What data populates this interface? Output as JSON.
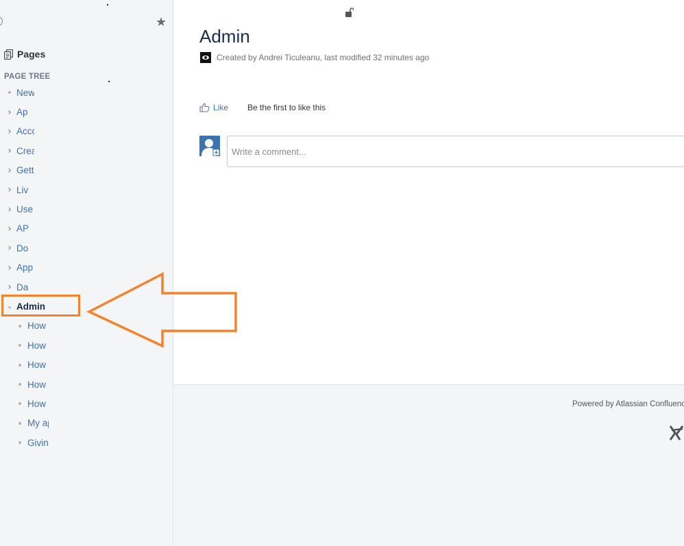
{
  "sidebar": {
    "pages_label": "Pages",
    "tree_heading": "PAGE TREE",
    "items": [
      {
        "label": "New",
        "marker": "bullet",
        "level": 0
      },
      {
        "label": "Ap",
        "marker": "chevron-right",
        "level": 0
      },
      {
        "label": "Acco",
        "marker": "chevron-right",
        "level": 0
      },
      {
        "label": "Crea",
        "marker": "chevron-right",
        "level": 0
      },
      {
        "label": "Getti",
        "marker": "chevron-right",
        "level": 0
      },
      {
        "label": "Liv",
        "marker": "chevron-right",
        "level": 0
      },
      {
        "label": "Use",
        "marker": "chevron-right",
        "level": 0
      },
      {
        "label": "AP",
        "marker": "chevron-right",
        "level": 0
      },
      {
        "label": "Do",
        "marker": "chevron-right",
        "level": 0
      },
      {
        "label": "App",
        "marker": "chevron-right",
        "level": 0
      },
      {
        "label": "Da",
        "marker": "chevron-right",
        "level": 0
      },
      {
        "label": "Admin",
        "marker": "chevron-down",
        "level": 0,
        "current": true
      },
      {
        "label": "How",
        "marker": "bullet",
        "level": 1
      },
      {
        "label": "How",
        "marker": "bullet",
        "level": 1
      },
      {
        "label": "How",
        "marker": "bullet",
        "level": 1
      },
      {
        "label": "How",
        "marker": "bullet",
        "level": 1
      },
      {
        "label": "How",
        "marker": "bullet",
        "level": 1
      },
      {
        "label": "My ap",
        "marker": "bullet",
        "level": 1
      },
      {
        "label": "Givin",
        "marker": "bullet",
        "level": 1
      }
    ]
  },
  "page": {
    "title": "Admin",
    "byline": "Created by Andrei Ticuleanu, last modified 32 minutes ago",
    "like_label": "Like",
    "like_prompt": "Be the first to like this",
    "comment_placeholder": "Write a comment..."
  },
  "footer": {
    "powered_by": "Powered by Atlassian Confluence"
  },
  "icons": {
    "star": "star-icon",
    "lock": "unlocked-icon",
    "pages": "pages-icon",
    "like": "thumbs-up-icon",
    "avatar": "user-avatar-icon",
    "logo": "atlassian-logo-icon"
  },
  "colors": {
    "link": "#3b73af",
    "highlight": "#f6812b",
    "title": "#172b4d"
  }
}
